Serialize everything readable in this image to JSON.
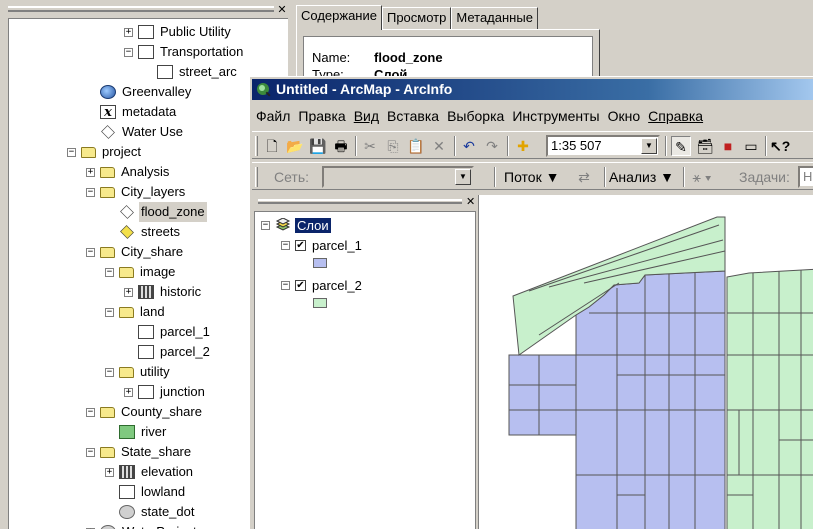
{
  "catalog_tree": {
    "items": [
      {
        "label": "Public Utility",
        "icon": "network-icon",
        "exp": "+"
      },
      {
        "label": "Transportation",
        "icon": "network-icon",
        "exp": "−"
      },
      {
        "label": "street_arc",
        "icon": "line-feature-icon",
        "exp": ""
      },
      {
        "label": "Greenvalley",
        "icon": "globe-icon",
        "exp": ""
      },
      {
        "label": "metadata",
        "icon": "xml-icon",
        "exp": ""
      },
      {
        "label": "Water Use",
        "icon": "polygon-icon",
        "exp": ""
      },
      {
        "label": "project",
        "icon": "folder-icon",
        "exp": "−"
      },
      {
        "label": "Analysis",
        "icon": "folder-icon",
        "exp": "+"
      },
      {
        "label": "City_layers",
        "icon": "folder-icon",
        "exp": "−"
      },
      {
        "label": "flood_zone",
        "icon": "polygon-icon",
        "exp": ""
      },
      {
        "label": "streets",
        "icon": "polygon-yellow-icon",
        "exp": ""
      },
      {
        "label": "City_share",
        "icon": "folder-icon",
        "exp": "−"
      },
      {
        "label": "image",
        "icon": "folder-icon",
        "exp": "−"
      },
      {
        "label": "historic",
        "icon": "raster-icon",
        "exp": "+"
      },
      {
        "label": "land",
        "icon": "folder-icon",
        "exp": "−"
      },
      {
        "label": "parcel_1",
        "icon": "coverage-icon",
        "exp": ""
      },
      {
        "label": "parcel_2",
        "icon": "coverage-icon",
        "exp": ""
      },
      {
        "label": "utility",
        "icon": "folder-icon",
        "exp": "−"
      },
      {
        "label": "junction",
        "icon": "network-icon",
        "exp": "+"
      },
      {
        "label": "County_share",
        "icon": "folder-icon",
        "exp": "−"
      },
      {
        "label": "river",
        "icon": "green-coverage-icon",
        "exp": ""
      },
      {
        "label": "State_share",
        "icon": "folder-icon",
        "exp": "−"
      },
      {
        "label": "elevation",
        "icon": "raster-icon",
        "exp": "+"
      },
      {
        "label": "lowland",
        "icon": "coverage-icon",
        "exp": ""
      },
      {
        "label": "state_dot",
        "icon": "tin-icon",
        "exp": ""
      },
      {
        "label": "WaterProject",
        "icon": "database-icon",
        "exp": "+"
      }
    ],
    "selected": "flood_zone"
  },
  "properties": {
    "tabs": [
      "Содержание",
      "Просмотр",
      "Метаданные"
    ],
    "active_tab": "Содержание",
    "name_key": "Name:",
    "name_value": "flood_zone",
    "type_key": "Type:",
    "type_value": "Слой"
  },
  "arcmap": {
    "title": "Untitled - ArcMap - ArcInfo",
    "menu": [
      "Файл",
      "Правка",
      "Вид",
      "Вставка",
      "Выборка",
      "Инструменты",
      "Окно",
      "Справка"
    ],
    "scale": "1:35 507",
    "network_label": "Сеть:",
    "flow_label": "Поток",
    "analysis_label": "Анализ",
    "tasks_label": "Задачи:",
    "tasks_value": "На"
  },
  "toc": {
    "root": "Слои",
    "layers": [
      {
        "name": "parcel_1",
        "checked": true,
        "color": "#b7bff0"
      },
      {
        "name": "parcel_2",
        "checked": true,
        "color": "#c8f0cc"
      }
    ]
  },
  "colors": {
    "parcel_1_fill": "#b7bff0",
    "parcel_2_fill": "#c8f0cc",
    "title_bar": "#0a246a"
  }
}
